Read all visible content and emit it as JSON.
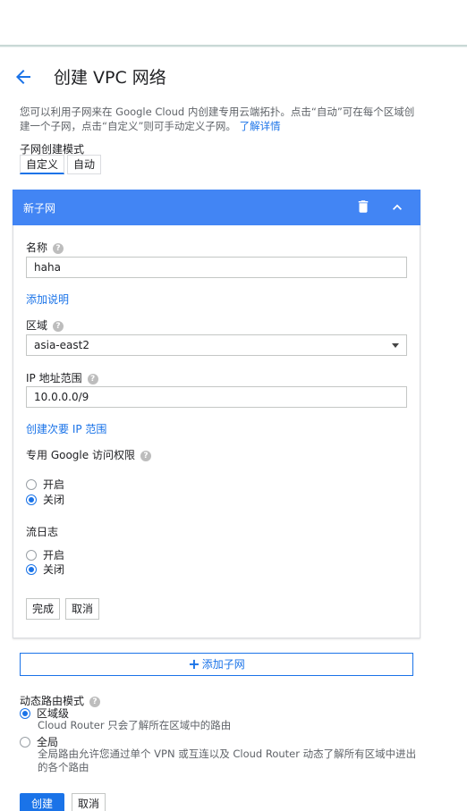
{
  "header": {
    "title": "创建 VPC 网络"
  },
  "intro": {
    "text": "您可以利用子网来在 Google Cloud 内创建专用云端拓扑。点击“自动”可在每个区域创建一个子网，点击“自定义”则可手动定义子网。",
    "learn_more": "了解详情"
  },
  "subnet_mode": {
    "label": "子网创建模式",
    "options": [
      "自定义",
      "自动"
    ],
    "selected": "自定义"
  },
  "subnet": {
    "title": "新子网",
    "name_label": "名称",
    "name_value": "haha",
    "add_description": "添加说明",
    "region_label": "区域",
    "region_value": "asia-east2",
    "ip_label": "IP 地址范围",
    "ip_value": "10.0.0.0/9",
    "secondary_ip": "创建次要 IP 范围",
    "private_google_label": "专用 Google 访问权限",
    "private_google_options": [
      "开启",
      "关闭"
    ],
    "private_google_selected": "关闭",
    "flow_logs_label": "流日志",
    "flow_logs_options": [
      "开启",
      "关闭"
    ],
    "flow_logs_selected": "关闭",
    "done_label": "完成",
    "cancel_label": "取消"
  },
  "add_subnet": {
    "label": "添加子网"
  },
  "routing": {
    "label": "动态路由模式",
    "options": [
      {
        "label": "区域级",
        "description": "Cloud Router 只会了解所在区域中的路由"
      },
      {
        "label": "全局",
        "description": "全局路由允许您通过单个 VPN 或互连以及 Cloud Router 动态了解所有区域中进出的各个路由"
      }
    ],
    "selected": "区域级"
  },
  "footer": {
    "create_label": "创建",
    "cancel_label": "取消"
  },
  "colors": {
    "accent": "#1a73e8",
    "card_header": "#4285f4"
  }
}
